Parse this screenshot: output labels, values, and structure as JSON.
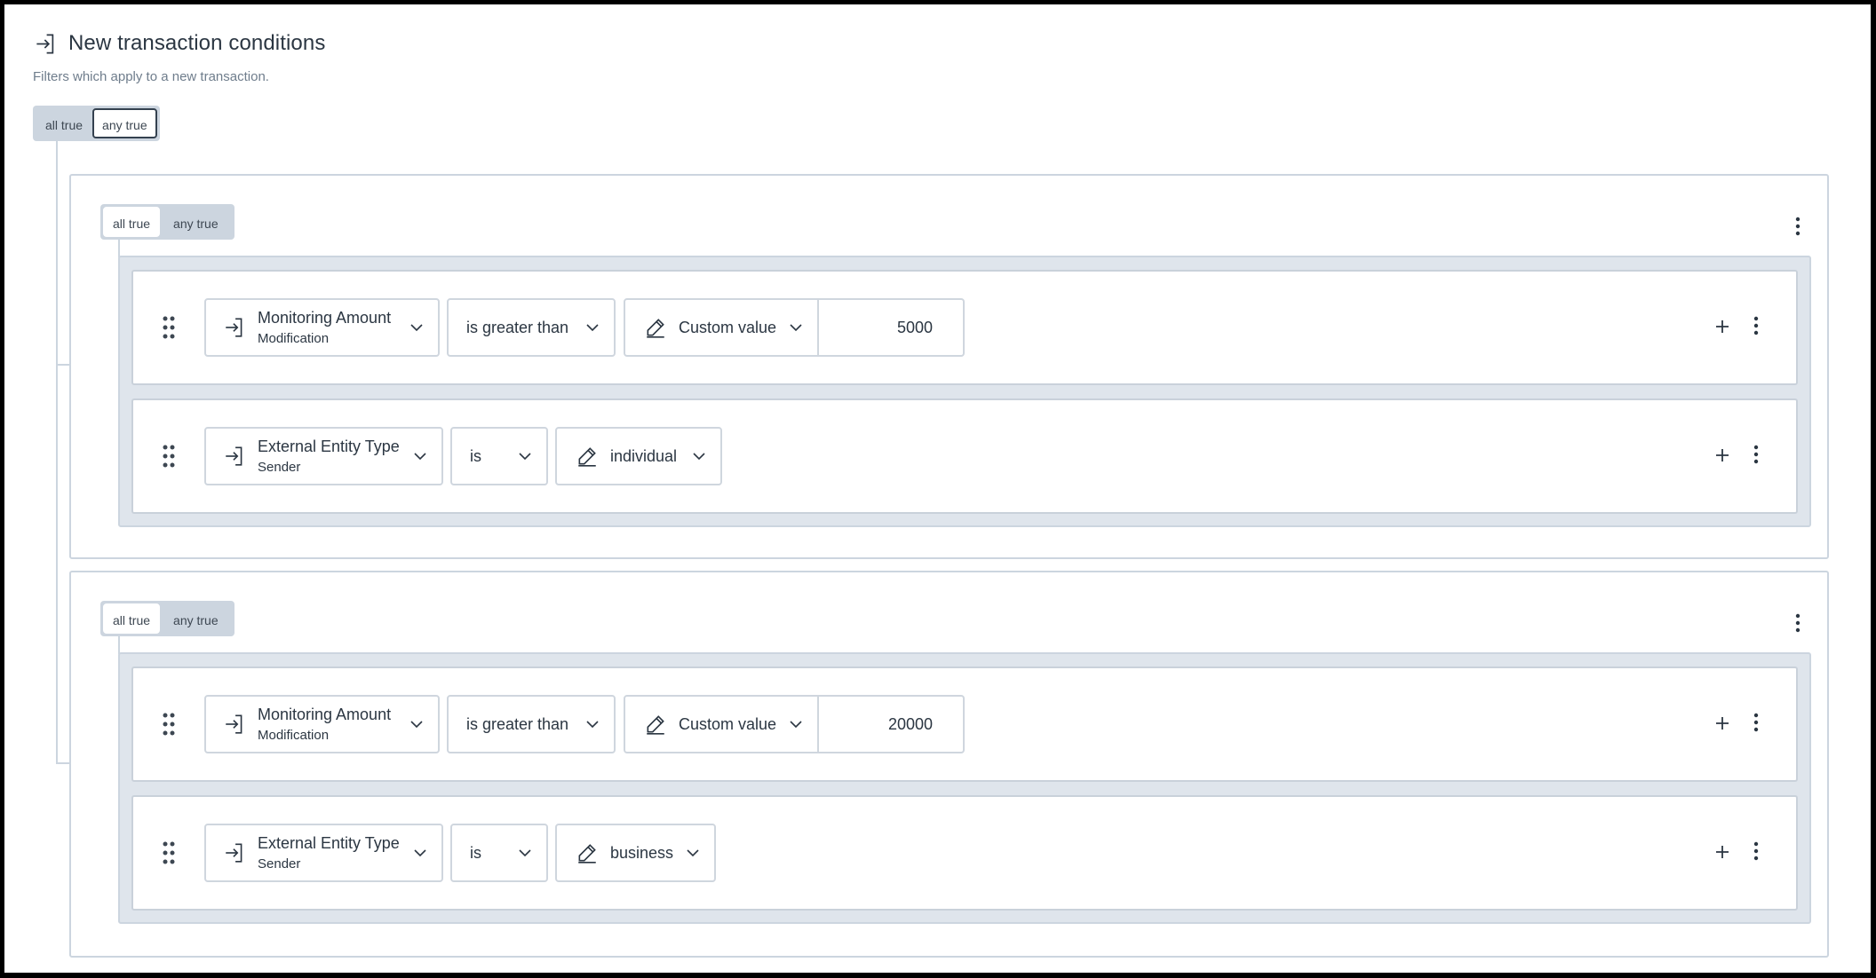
{
  "header": {
    "title": "New transaction conditions",
    "subtitle": "Filters which apply to a new transaction."
  },
  "root_toggle": {
    "all": "all true",
    "any": "any true",
    "selected": "any true"
  },
  "groups": [
    {
      "toggle": {
        "all": "all true",
        "any": "any true",
        "selected": "all true"
      },
      "conditions": [
        {
          "field_main": "Monitoring Amount",
          "field_sub": "Modification",
          "operator": "is greater than",
          "value_type": "Custom value",
          "value": "5000"
        },
        {
          "field_main": "External Entity Type",
          "field_sub": "Sender",
          "operator": "is",
          "value_type": "individual"
        }
      ]
    },
    {
      "toggle": {
        "all": "all true",
        "any": "any true",
        "selected": "all true"
      },
      "conditions": [
        {
          "field_main": "Monitoring Amount",
          "field_sub": "Modification",
          "operator": "is greater than",
          "value_type": "Custom value",
          "value": "20000"
        },
        {
          "field_main": "External Entity Type",
          "field_sub": "Sender",
          "operator": "is",
          "value_type": "business"
        }
      ]
    }
  ],
  "icons": {
    "field": "login-arrow-icon",
    "value": "pencil-icon",
    "drag": "drag-handle-icon",
    "add": "plus-icon",
    "menu": "more-vertical-icon",
    "dropdown": "chevron-down-icon"
  },
  "colors": {
    "text": "#2b3642",
    "muted": "#6f7d8c",
    "line": "#ccd5df",
    "inner_bg": "#dfe5ec"
  }
}
